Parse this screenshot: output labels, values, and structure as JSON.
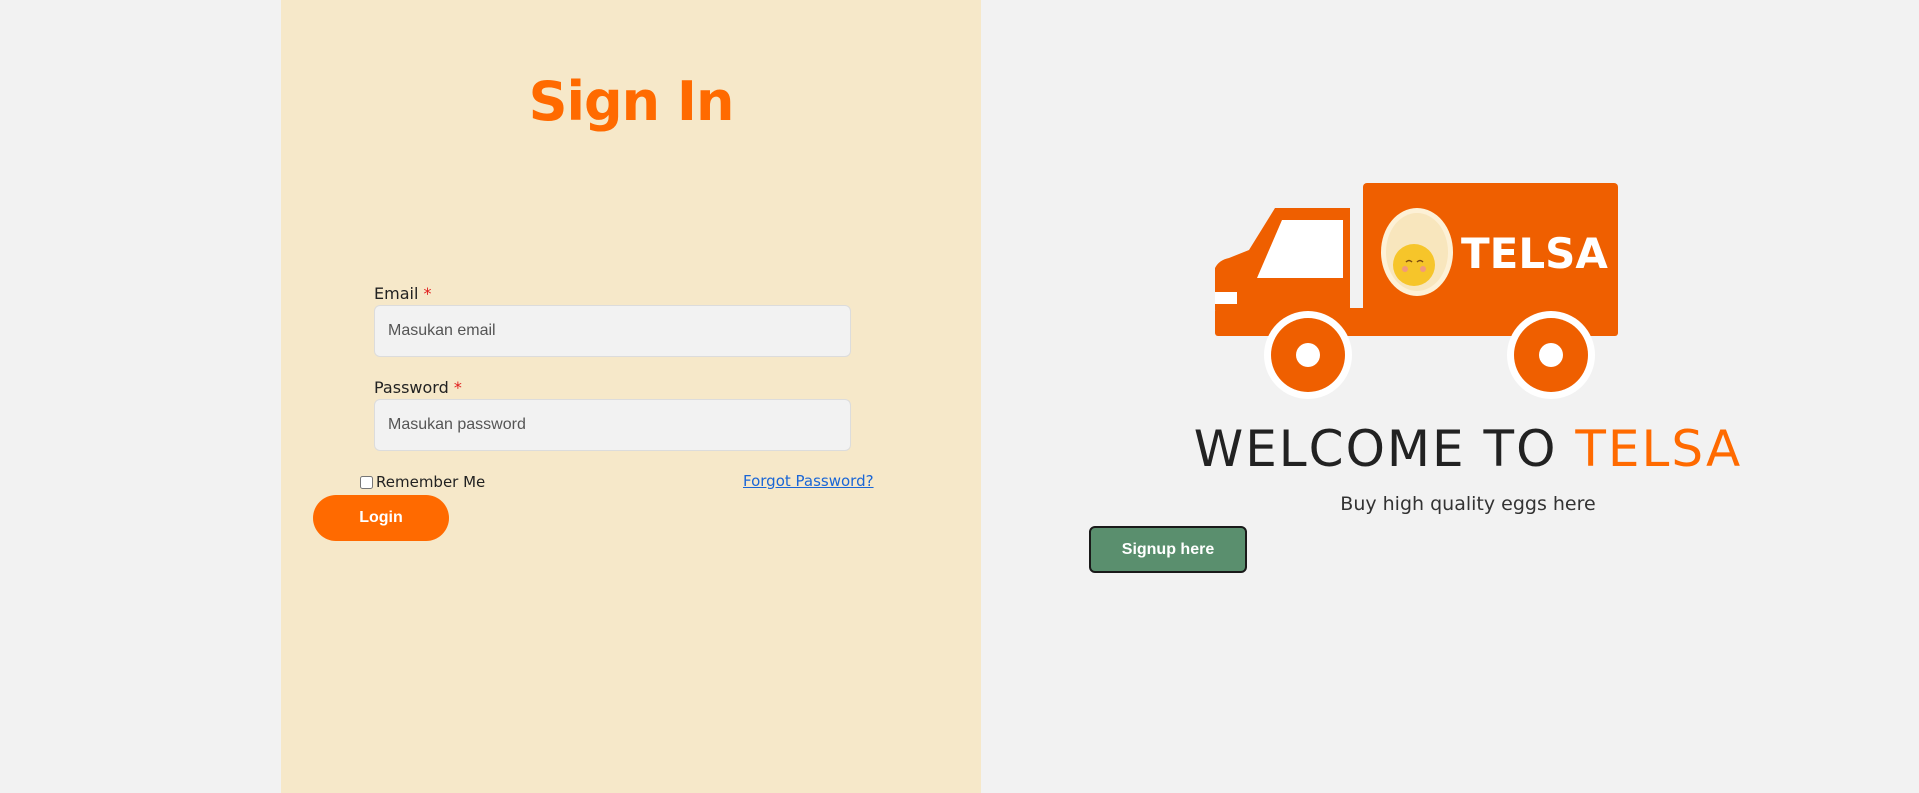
{
  "login": {
    "title": "Sign In",
    "email_label": "Email",
    "email_required": "*",
    "email_placeholder": "Masukan email",
    "password_label": "Password",
    "password_required": "*",
    "password_placeholder": "Masukan password",
    "remember_label": "Remember Me",
    "forgot_link": "Forgot Password?",
    "login_button": "Login"
  },
  "hero": {
    "logo_text": "TELSA",
    "welcome_prefix": "WELCOME TO ",
    "welcome_brand": "TELSA",
    "tagline": "Buy high quality eggs here",
    "signup_button": "Signup here"
  },
  "colors": {
    "accent": "#ff6a00",
    "panel": "#f6e8c9",
    "background": "#f2f2f2",
    "signup": "#5a8f6e",
    "link": "#1a66d6",
    "truck": "#ef5f00"
  },
  "icons": {
    "logo": "truck-egg-logo"
  }
}
